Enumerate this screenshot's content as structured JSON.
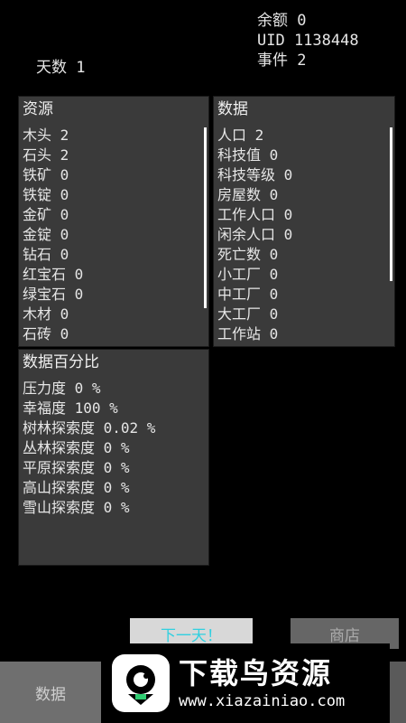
{
  "header": {
    "balance": "余额 0",
    "uid": "UID 1138448",
    "events": "事件 2",
    "day": "天数 1"
  },
  "resources_panel": {
    "title": "资源",
    "items": [
      "木头 2",
      "石头 2",
      "铁矿 0",
      "铁锭 0",
      "金矿 0",
      "金锭 0",
      "钻石 0",
      "红宝石 0",
      "绿宝石 0",
      "木材 0",
      "石砖 0"
    ]
  },
  "data_panel": {
    "title": "数据",
    "items": [
      "人口 2",
      "科技值 0",
      "科技等级 0",
      "房屋数 0",
      "工作人口 0",
      "闲余人口 0",
      "死亡数 0",
      "小工厂 0",
      "中工厂 0",
      "大工厂 0",
      "工作站 0"
    ]
  },
  "percent_panel": {
    "title": "数据百分比",
    "items": [
      "压力度 0 %",
      "幸福度 100 %",
      "树林探索度 0.02 %",
      "丛林探索度 0 %",
      "平原探索度 0 %",
      "高山探索度 0 %",
      "雪山探索度 0 %"
    ]
  },
  "buttons": {
    "next_day": "下一天！",
    "shop": "商店"
  },
  "tabs": {
    "data": "数据"
  },
  "watermark": {
    "title": "下载鸟资源",
    "url": "www.xiazainiao.com"
  }
}
